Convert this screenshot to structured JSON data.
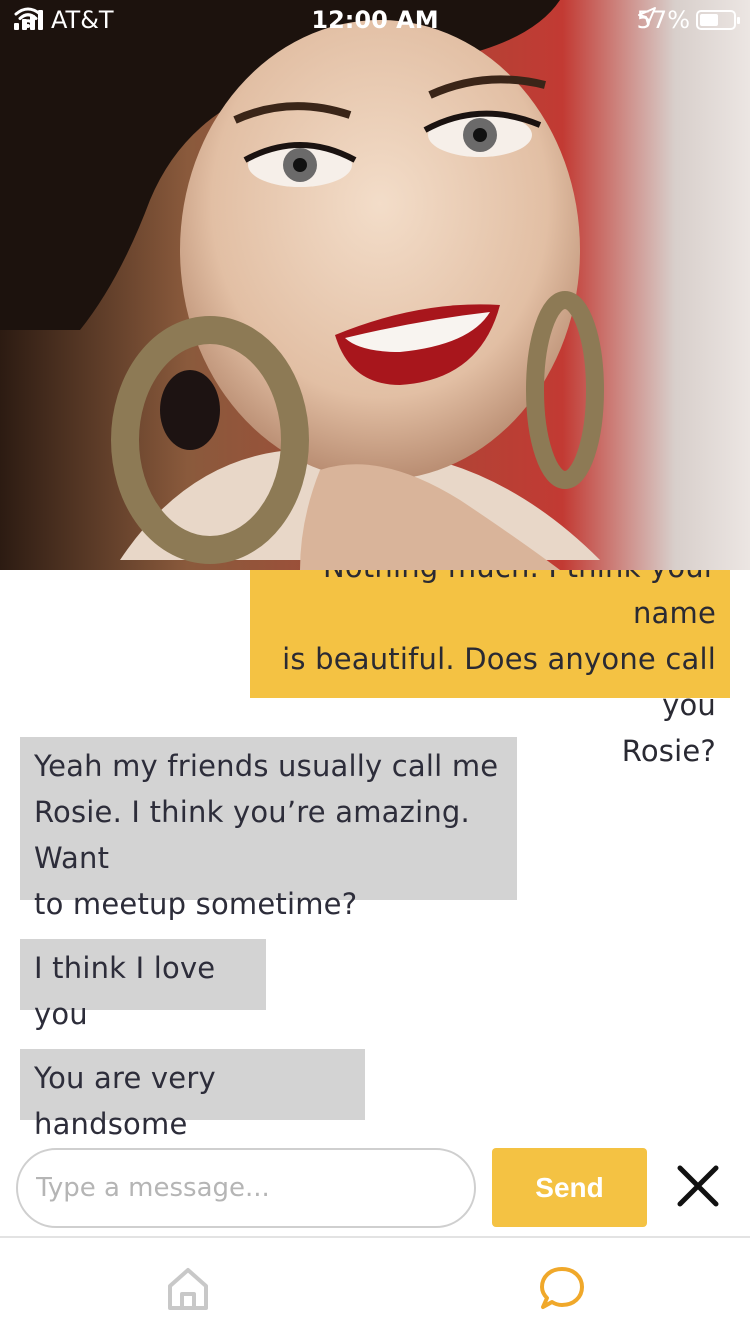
{
  "status_bar": {
    "carrier": "AT&T",
    "time": "12:00 AM",
    "battery_percent": "57%",
    "battery_level": 0.57
  },
  "header": {
    "photo": "profile-photo"
  },
  "messages": [
    {
      "from": "me",
      "lines": [
        "Nothing much. I think your name",
        "is beautiful. Does anyone call you",
        "Rosie?"
      ]
    },
    {
      "from": "them",
      "lines": [
        "Yeah my friends usually call me",
        "Rosie. I think you’re amazing. Want",
        "to meetup sometime?"
      ]
    },
    {
      "from": "them",
      "lines": [
        "I think I love you"
      ]
    },
    {
      "from": "them",
      "lines": [
        "You are very handsome"
      ]
    }
  ],
  "composer": {
    "placeholder": "Type a message...",
    "value": "",
    "send_label": "Send"
  },
  "tabs": [
    {
      "name": "home",
      "icon": "home-icon",
      "active": false
    },
    {
      "name": "chat",
      "icon": "chat-bubble-icon",
      "active": true
    }
  ],
  "colors": {
    "accent": "#f4c243",
    "received_bubble": "#d3d3d3",
    "inactive_icon": "#c8c8c8"
  }
}
